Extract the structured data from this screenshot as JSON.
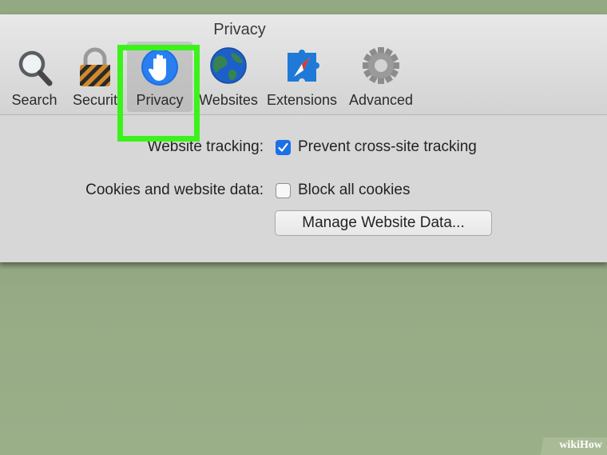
{
  "window": {
    "title": "Privacy"
  },
  "toolbar": {
    "tabs": [
      {
        "label": "Search",
        "icon": "magnifier-icon"
      },
      {
        "label": "Securit",
        "icon": "padlock-icon"
      },
      {
        "label": "Privacy",
        "icon": "hand-icon",
        "selected": true
      },
      {
        "label": "Websites",
        "icon": "globe-icon"
      },
      {
        "label": "Extensions",
        "icon": "puzzle-compass-icon"
      },
      {
        "label": "Advanced",
        "icon": "gear-icon"
      }
    ]
  },
  "privacy": {
    "tracking": {
      "label": "Website tracking:",
      "option": "Prevent cross-site tracking",
      "checked": true
    },
    "cookies": {
      "label": "Cookies and website data:",
      "option": "Block all cookies",
      "checked": false
    },
    "manage_button": "Manage Website Data..."
  },
  "watermark": {
    "text_prefix": "wiki",
    "text_suffix": "How"
  },
  "colors": {
    "highlight": "#3cf21b",
    "accent": "#1d6fe6"
  }
}
